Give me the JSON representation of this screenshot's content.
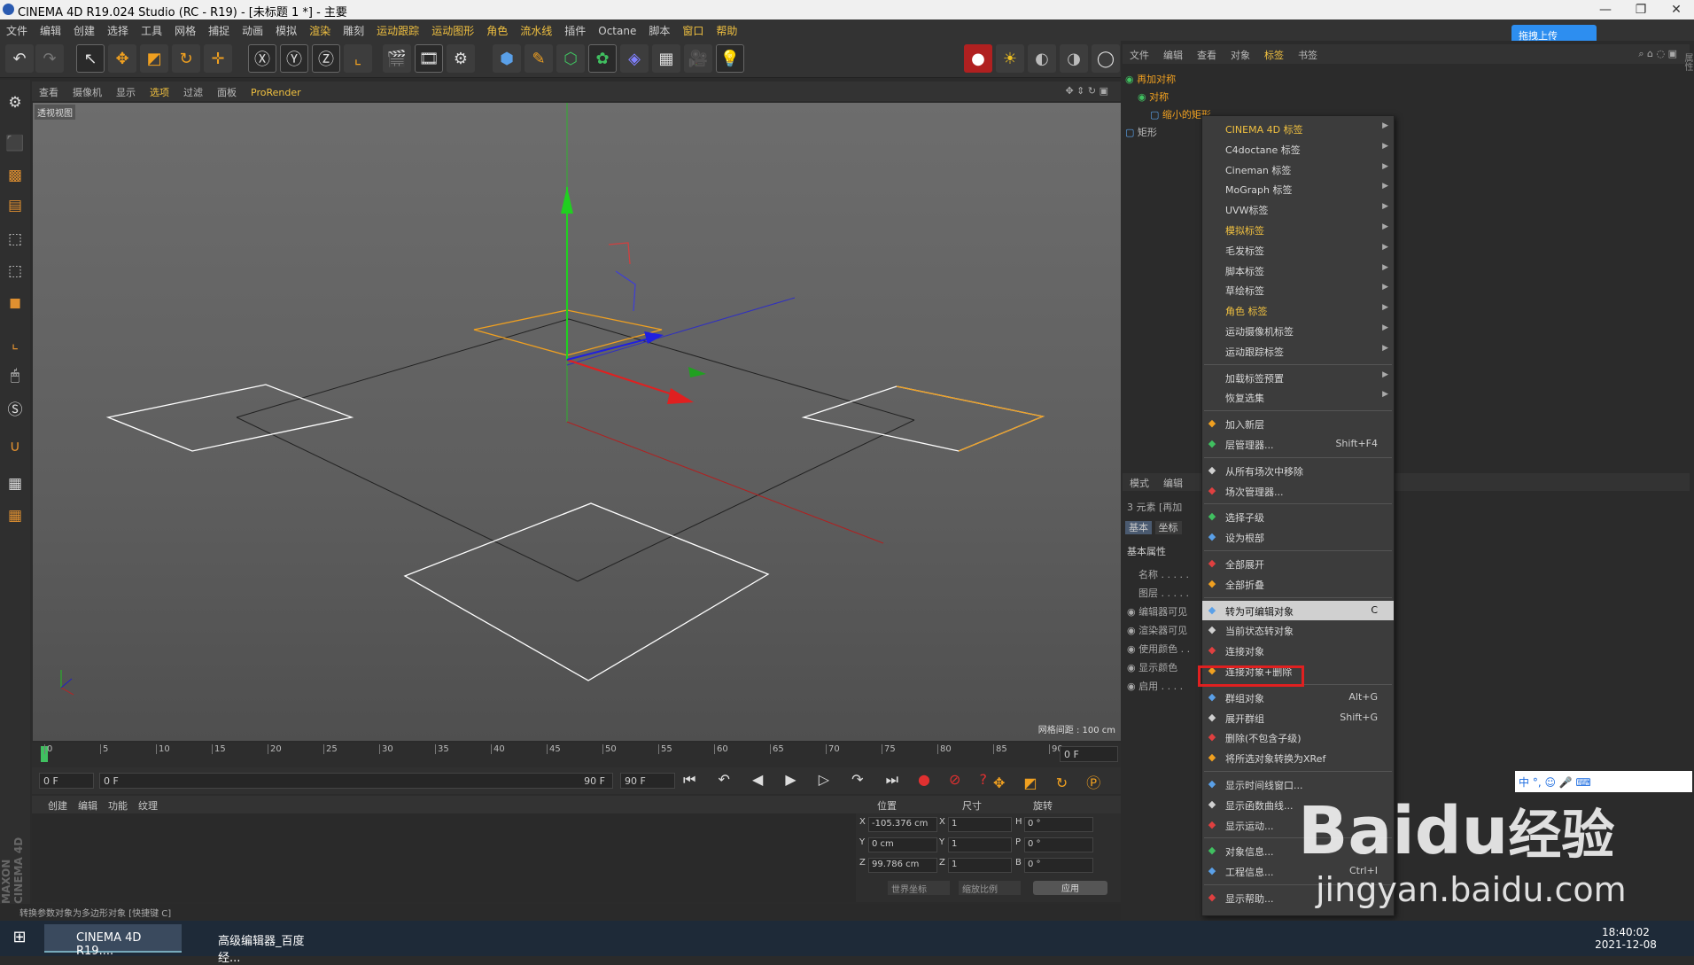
{
  "window": {
    "title": "CINEMA 4D R19.024 Studio (RC - R19) - [未标题 1 *] - 主要",
    "minimize": "—",
    "restore": "❐",
    "close": "✕"
  },
  "menubar": [
    "文件",
    "编辑",
    "创建",
    "选择",
    "工具",
    "网格",
    "捕捉",
    "动画",
    "模拟",
    "渲染",
    "雕刻",
    "运动跟踪",
    "运动图形",
    "角色",
    "流水线",
    "插件",
    "Octane",
    "脚本",
    "窗口",
    "帮助"
  ],
  "cloud_upload": "拖拽上传",
  "viewport_menu": [
    "查看",
    "摄像机",
    "显示",
    "选项",
    "过滤",
    "面板",
    "ProRender"
  ],
  "viewport": {
    "label": "透视视图",
    "grid_spacing": "网格间距 : 100 cm"
  },
  "timeline": {
    "ticks": [
      "0",
      "5",
      "10",
      "15",
      "20",
      "25",
      "30",
      "35",
      "40",
      "45",
      "50",
      "55",
      "60",
      "65",
      "70",
      "75",
      "80",
      "85",
      "90"
    ],
    "current_frame": "0 F",
    "start": "0 F",
    "range_start": "0 F",
    "range_end": "90 F",
    "end": "90 F"
  },
  "material_menu": [
    "创建",
    "编辑",
    "功能",
    "纹理"
  ],
  "coords": {
    "headers": [
      "位置",
      "尺寸",
      "旋转"
    ],
    "rows": [
      {
        "axis": "X",
        "pos": "-105.376 cm",
        "size_axis": "X",
        "size": "1",
        "rot_axis": "H",
        "rot": "0 °"
      },
      {
        "axis": "Y",
        "pos": "0 cm",
        "size_axis": "Y",
        "size": "1",
        "rot_axis": "P",
        "rot": "0 °"
      },
      {
        "axis": "Z",
        "pos": "99.786 cm",
        "size_axis": "Z",
        "size": "1",
        "rot_axis": "B",
        "rot": "0 °"
      }
    ],
    "world": "世界坐标",
    "scale": "缩放比例",
    "apply": "应用"
  },
  "status": "转换参数对象为多边形对象 [快捷键 C]",
  "object_manager": {
    "menu": [
      "文件",
      "编辑",
      "查看",
      "对象",
      "标签",
      "书签"
    ],
    "objects": [
      {
        "name": "再加对称",
        "indent": 0
      },
      {
        "name": "对称",
        "indent": 1
      },
      {
        "name": "缩小的矩形",
        "indent": 2
      },
      {
        "name": "矩形",
        "indent": 0
      }
    ]
  },
  "attributes": {
    "menu": [
      "模式",
      "编辑"
    ],
    "summary": "3 元素 [再加",
    "tabs": [
      "基本",
      "坐标"
    ],
    "section": "基本属性",
    "fields": [
      "名称 . . . . .",
      "图层 . . . . .",
      "编辑器可见",
      "渲染器可见",
      "使用颜色 . .",
      "显示颜色",
      "启用 . . . ."
    ]
  },
  "context_menu": [
    {
      "label": "CINEMA 4D 标签",
      "arrow": true,
      "hl": true
    },
    {
      "label": "C4doctane 标签",
      "arrow": true
    },
    {
      "label": "Cineman 标签",
      "arrow": true
    },
    {
      "label": "MoGraph 标签",
      "arrow": true
    },
    {
      "label": "UVW标签",
      "arrow": true
    },
    {
      "label": "模拟标签",
      "arrow": true,
      "hl": true
    },
    {
      "label": "毛发标签",
      "arrow": true
    },
    {
      "label": "脚本标签",
      "arrow": true
    },
    {
      "label": "草绘标签",
      "arrow": true
    },
    {
      "label": "角色 标签",
      "arrow": true,
      "hl": true
    },
    {
      "label": "运动摄像机标签",
      "arrow": true
    },
    {
      "label": "运动跟踪标签",
      "arrow": true
    },
    {
      "sep": true
    },
    {
      "label": "加载标签预置",
      "arrow": true
    },
    {
      "label": "恢复选集",
      "arrow": true
    },
    {
      "sep": true
    },
    {
      "label": "加入新层",
      "icon": "layer-add"
    },
    {
      "label": "层管理器...",
      "shortcut": "Shift+F4",
      "icon": "layer-manager"
    },
    {
      "sep": true
    },
    {
      "label": "从所有场次中移除",
      "icon": "take-remove"
    },
    {
      "label": "场次管理器...",
      "icon": "take-manager"
    },
    {
      "sep": true
    },
    {
      "label": "选择子级",
      "icon": "select-children"
    },
    {
      "label": "设为根部",
      "icon": "set-root"
    },
    {
      "sep": true
    },
    {
      "label": "全部展开",
      "icon": "expand-all"
    },
    {
      "label": "全部折叠",
      "icon": "collapse-all"
    },
    {
      "sep": true
    },
    {
      "label": "转为可编辑对象",
      "shortcut": "C",
      "active": true,
      "icon": "make-editable"
    },
    {
      "label": "当前状态转对象",
      "icon": "current-state"
    },
    {
      "label": "连接对象",
      "icon": "connect"
    },
    {
      "label": "连接对象+删除",
      "icon": "connect-delete"
    },
    {
      "sep": true
    },
    {
      "label": "群组对象",
      "shortcut": "Alt+G",
      "icon": "group"
    },
    {
      "label": "展开群组",
      "shortcut": "Shift+G",
      "icon": "ungroup"
    },
    {
      "label": "删除(不包含子级)",
      "icon": "delete-no-children"
    },
    {
      "label": "将所选对象转换为XRef",
      "icon": "xref"
    },
    {
      "sep": true
    },
    {
      "label": "显示时间线窗口...",
      "icon": "timeline"
    },
    {
      "label": "显示函数曲线...",
      "icon": "fcurve"
    },
    {
      "label": "显示运动...",
      "icon": "motion"
    },
    {
      "sep": true
    },
    {
      "label": "对象信息...",
      "icon": "object-info"
    },
    {
      "label": "工程信息...",
      "shortcut": "Ctrl+I",
      "icon": "project-info"
    },
    {
      "sep": true
    },
    {
      "label": "显示帮助...",
      "icon": "help"
    }
  ],
  "taskbar": {
    "apps": [
      "CINEMA 4D R19....",
      "高级编辑器_百度经..."
    ],
    "time": "18:40:02",
    "date": "2021-12-08"
  },
  "watermark": {
    "brand": "Baidu",
    "cn": "经验",
    "url": "jingyan.baidu.com"
  },
  "ime": "中 °, ☺ 🎤 ⌨"
}
